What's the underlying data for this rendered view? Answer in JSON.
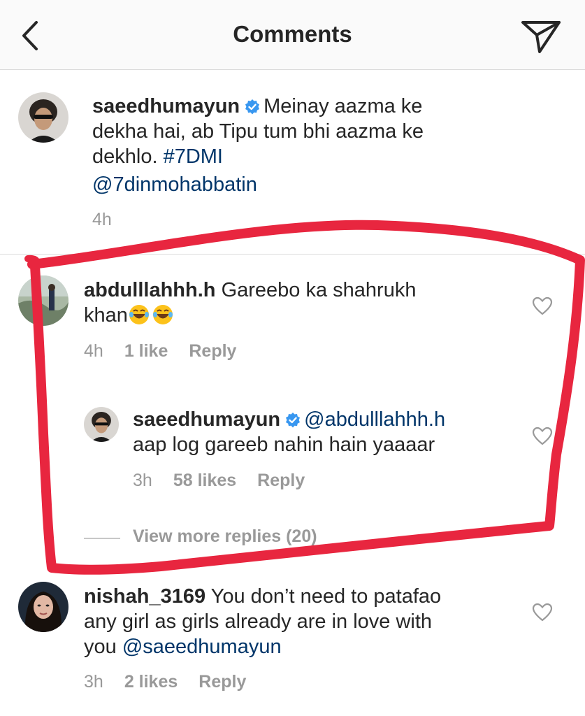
{
  "header": {
    "title": "Comments",
    "back_icon": "chevron-left-icon",
    "send_icon": "paper-plane-icon"
  },
  "caption": {
    "username": "saeedhumayun",
    "text": "Meinay aazma ke",
    "text_line2": "dekha hai, ab Tipu tum bhi aazma ke",
    "text_line3": "dekhlo.",
    "hashtag": "#7DMI",
    "mention": "@7dinmohabbatin",
    "time": "4h"
  },
  "comments": [
    {
      "username": "abdulllahhh.h",
      "text_line1": "Gareebo ka shahrukh",
      "text_line2": "khan",
      "emoji": "😂😂",
      "time": "4h",
      "likes": "1 like",
      "reply": "Reply",
      "replies": [
        {
          "username": "saeedhumayun",
          "mention": "@abdulllahhh.h",
          "text": "aap log gareeb nahin hain yaaaar",
          "time": "3h",
          "likes": "58 likes",
          "reply": "Reply"
        }
      ],
      "view_more": "View more replies (20)"
    },
    {
      "username": "nishah_3169",
      "text_line1": "You don’t need to patafao",
      "text_line2": "any girl as girls already are in love with",
      "text_line3": "you",
      "mention": "@saeedhumayun",
      "time": "3h",
      "likes": "2 likes",
      "reply": "Reply"
    }
  ],
  "colors": {
    "text": "#262626",
    "meta": "#999999",
    "link": "#003569",
    "verified": "#3897f0",
    "annotation": "#e8263f",
    "divider": "#dbdbdb"
  }
}
